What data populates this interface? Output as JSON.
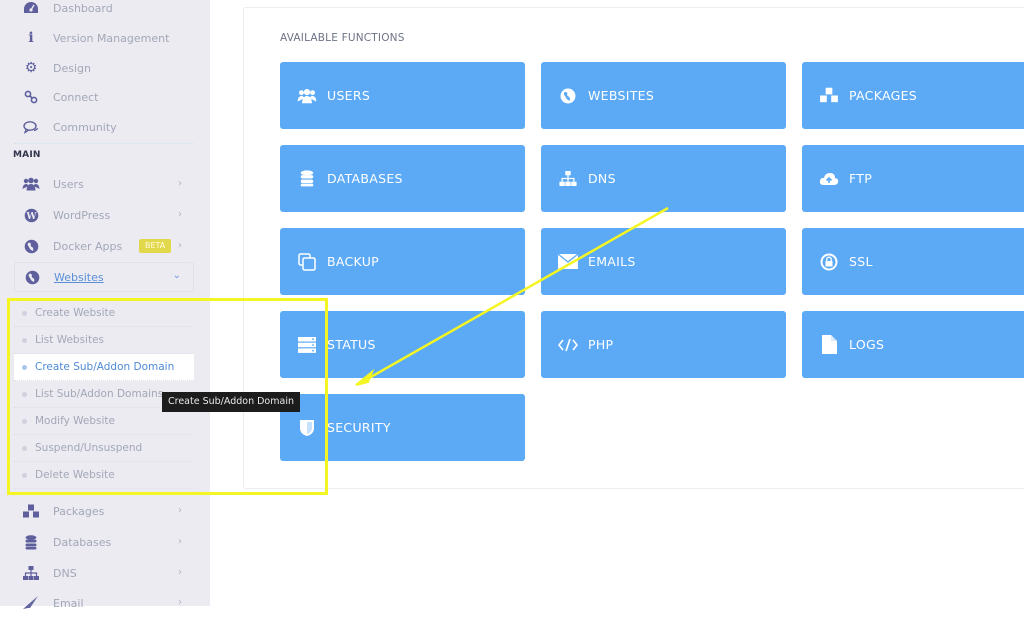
{
  "sidebar": {
    "top_items": [
      {
        "label": "Dashboard",
        "icon": "dashboard-icon"
      },
      {
        "label": "Version Management",
        "icon": "info-icon"
      },
      {
        "label": "Design",
        "icon": "gear-icon"
      },
      {
        "label": "Connect",
        "icon": "link-icon"
      },
      {
        "label": "Community",
        "icon": "comments-icon"
      }
    ],
    "section_title": "MAIN",
    "main_items": [
      {
        "label": "Users",
        "icon": "users-icon",
        "chevron": "›"
      },
      {
        "label": "WordPress",
        "icon": "wordpress-icon",
        "chevron": "›"
      },
      {
        "label": "Docker Apps",
        "icon": "globe-icon",
        "chevron": "›",
        "badge": "BETA"
      },
      {
        "label": "Websites",
        "icon": "globe-icon",
        "chevron": "⌄"
      }
    ],
    "websites_submenu": [
      {
        "label": "Create Website"
      },
      {
        "label": "List Websites"
      },
      {
        "label": "Create Sub/Addon Domain",
        "active": true
      },
      {
        "label": "List Sub/Addon Domains"
      },
      {
        "label": "Modify Website"
      },
      {
        "label": "Suspend/Unsuspend"
      },
      {
        "label": "Delete Website"
      }
    ],
    "bottom_items": [
      {
        "label": "Packages",
        "icon": "cubes-icon",
        "chevron": "›"
      },
      {
        "label": "Databases",
        "icon": "database-icon",
        "chevron": "›"
      },
      {
        "label": "DNS",
        "icon": "sitemap-icon",
        "chevron": "›"
      },
      {
        "label": "Email",
        "icon": "paper-plane-icon",
        "chevron": "›"
      }
    ],
    "tooltip": "Create Sub/Addon Domain"
  },
  "main": {
    "title": "AVAILABLE FUNCTIONS",
    "functions": [
      {
        "label": "USERS",
        "icon": "users-icon"
      },
      {
        "label": "WEBSITES",
        "icon": "globe-icon"
      },
      {
        "label": "PACKAGES",
        "icon": "cubes-icon"
      },
      {
        "label": "DATABASES",
        "icon": "database-icon"
      },
      {
        "label": "DNS",
        "icon": "sitemap-icon"
      },
      {
        "label": "FTP",
        "icon": "cloud-upload-icon"
      },
      {
        "label": "BACKUP",
        "icon": "copy-icon"
      },
      {
        "label": "EMAILS",
        "icon": "envelope-icon"
      },
      {
        "label": "SSL",
        "icon": "lock-icon"
      },
      {
        "label": "STATUS",
        "icon": "server-icon"
      },
      {
        "label": "PHP",
        "icon": "code-icon"
      },
      {
        "label": "LOGS",
        "icon": "file-icon"
      },
      {
        "label": "SECURITY",
        "icon": "shield-icon"
      }
    ]
  },
  "colors": {
    "accent_button": "#5caaf5",
    "annotation_yellow": "#f5f523",
    "badge_yellow": "#e1d84b",
    "sidebar_bg": "#ebebf1"
  }
}
